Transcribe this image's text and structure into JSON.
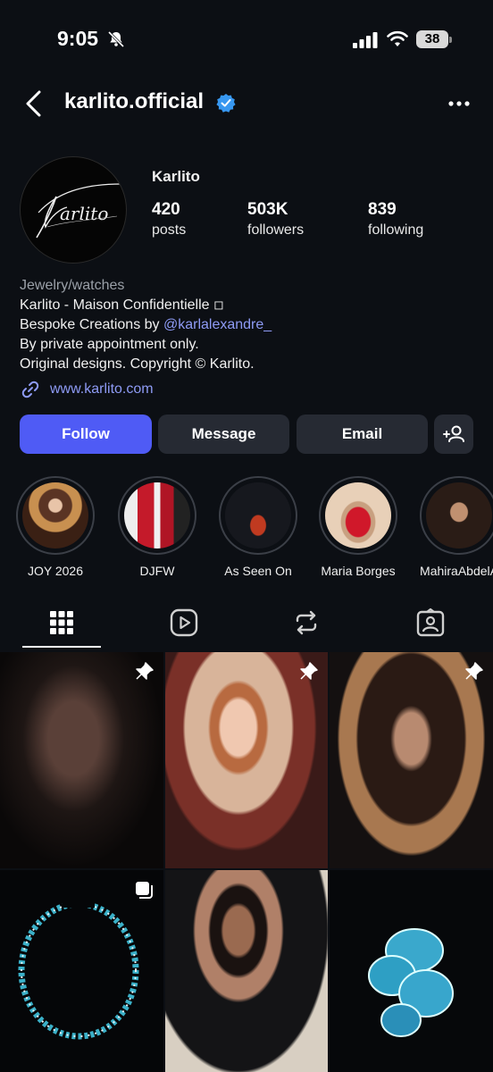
{
  "status_bar": {
    "time": "9:05",
    "battery": "38"
  },
  "header": {
    "username": "karlito.official"
  },
  "profile": {
    "name": "Karlito",
    "stats": [
      {
        "value": "420",
        "label": "posts"
      },
      {
        "value": "503K",
        "label": "followers"
      },
      {
        "value": "839",
        "label": "following"
      }
    ],
    "bio": {
      "category": "Jewelry/watches",
      "line1": "Karlito - Maison Confidentielle ◽",
      "line2_prefix": "Bespoke Creations by ",
      "line2_mention": "@karlalexandre_",
      "line3": "By private appointment only.",
      "line4": "Original designs. Copyright © Karlito."
    },
    "website": "www.karlito.com",
    "avatar_logo_text": "Karlito"
  },
  "buttons": {
    "follow": "Follow",
    "message": "Message",
    "email": "Email"
  },
  "highlights": [
    {
      "label": "JOY 2026"
    },
    {
      "label": "DJFW"
    },
    {
      "label": "As Seen On"
    },
    {
      "label": "Maria Borges"
    },
    {
      "label": "MahiraAbdelA"
    }
  ],
  "tabs": [
    "grid-icon",
    "reels-icon",
    "reposts-icon",
    "tagged-icon"
  ],
  "colors": {
    "accent": "#4f5bf5",
    "link": "#8e9bf5",
    "background": "#0c0f14",
    "button": "#262a33"
  }
}
